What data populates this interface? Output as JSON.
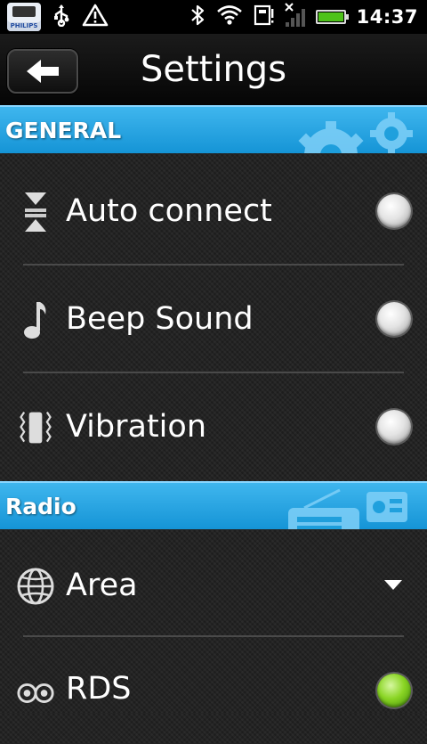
{
  "status_bar": {
    "time": "14:37",
    "app_badge": "PHILIPS",
    "left_icons": [
      "philips-app-icon",
      "usb-icon",
      "warning-icon"
    ],
    "right_icons": [
      "bluetooth-icon",
      "wifi-icon",
      "sim-storage-icon",
      "signal-icon",
      "battery-icon"
    ],
    "battery_level": 1.0,
    "battery_color": "#4ec21a"
  },
  "titlebar": {
    "title": "Settings",
    "back_icon": "back-arrow-icon"
  },
  "sections": [
    {
      "label": "GENERAL",
      "deco_icon": "gear-icon",
      "items": [
        {
          "label": "Auto connect",
          "icon": "auto-connect-icon",
          "control": "radio",
          "checked": false
        },
        {
          "label": "Beep Sound",
          "icon": "music-note-icon",
          "control": "radio",
          "checked": false
        },
        {
          "label": "Vibration",
          "icon": "vibration-icon",
          "control": "radio",
          "checked": false
        }
      ]
    },
    {
      "label": "Radio",
      "deco_icon": "radio-icon",
      "items": [
        {
          "label": "Area",
          "icon": "globe-icon",
          "control": "dropdown"
        },
        {
          "label": "RDS",
          "icon": "rds-icon",
          "control": "radio",
          "checked": true
        }
      ]
    }
  ],
  "colors": {
    "section_blue": "#1594d6",
    "radio_on": "#8ad524",
    "background": "#232323"
  }
}
